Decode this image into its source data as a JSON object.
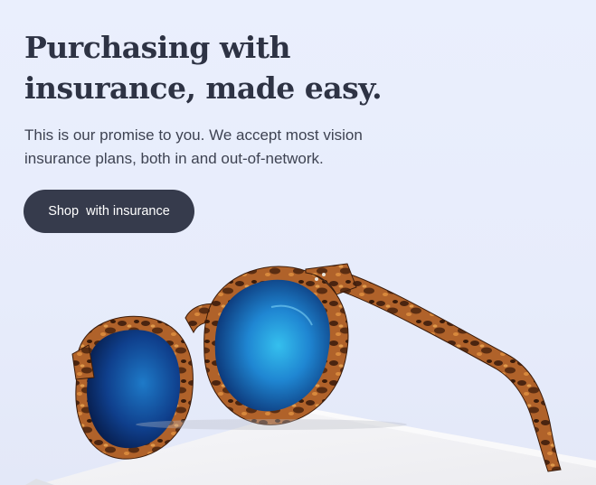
{
  "hero": {
    "headline_line1": "Purchasing with",
    "headline_line2": "insurance, made easy.",
    "subtext_line1": "This is our promise to you. We accept most vision",
    "subtext_line2": "insurance plans, both in and out-of-network.",
    "cta_label": "Shop  with insurance"
  },
  "image": {
    "subject": "tortoiseshell-sunglasses-blue-lenses-on-white-pedestal"
  },
  "colors": {
    "background": "#e9eefc",
    "headline": "#2e3344",
    "body_text": "#3e4352",
    "button_bg": "#363b4c",
    "button_text": "#ffffff",
    "lens_blue": "#1a7fd0",
    "frame_tortoise": "#8a4a1e"
  }
}
